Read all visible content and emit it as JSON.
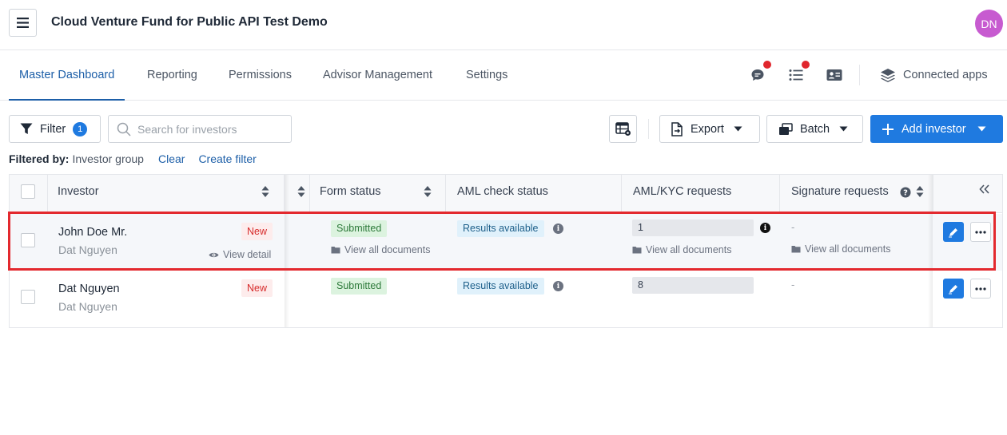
{
  "header": {
    "title": "Cloud Venture Fund for Public API Test Demo",
    "avatar_initials": "DN",
    "avatar_color": "#c75bd0"
  },
  "nav": {
    "tabs": [
      {
        "label": "Master Dashboard",
        "active": true
      },
      {
        "label": "Reporting",
        "active": false
      },
      {
        "label": "Permissions",
        "active": false
      },
      {
        "label": "Advisor Management",
        "active": false
      },
      {
        "label": "Settings",
        "active": false
      }
    ],
    "icons": [
      "chat-icon",
      "task-list-icon",
      "contact-card-icon"
    ],
    "connected_apps_label": "Connected apps"
  },
  "toolbar": {
    "filter_label": "Filter",
    "filter_count": "1",
    "search_placeholder": "Search for investors",
    "export_label": "Export",
    "batch_label": "Batch",
    "add_investor_label": "Add investor",
    "accent_color": "#1f7ae0"
  },
  "filter_bar": {
    "prefix": "Filtered by:",
    "value": "Investor group",
    "clear_label": "Clear",
    "create_label": "Create filter"
  },
  "table": {
    "columns": {
      "investor": "Investor",
      "form_status": "Form status",
      "aml_status": "AML check status",
      "aml_kyc": "AML/KYC requests",
      "signature": "Signature requests"
    },
    "rows": [
      {
        "name": "John Doe Mr.",
        "sub": "Dat Nguyen",
        "badge": "New",
        "view_detail": "View detail",
        "form_status": "Submitted",
        "form_docs": "View all documents",
        "aml_status": "Results available",
        "aml_kyc_count": "1",
        "aml_kyc_docs": "View all documents",
        "signature": "-",
        "signature_docs": "View all documents"
      },
      {
        "name": "Dat Nguyen",
        "sub": "Dat Nguyen",
        "badge": "New",
        "form_status": "Submitted",
        "aml_status": "Results available",
        "aml_kyc_count": "8",
        "signature": "-"
      }
    ]
  }
}
